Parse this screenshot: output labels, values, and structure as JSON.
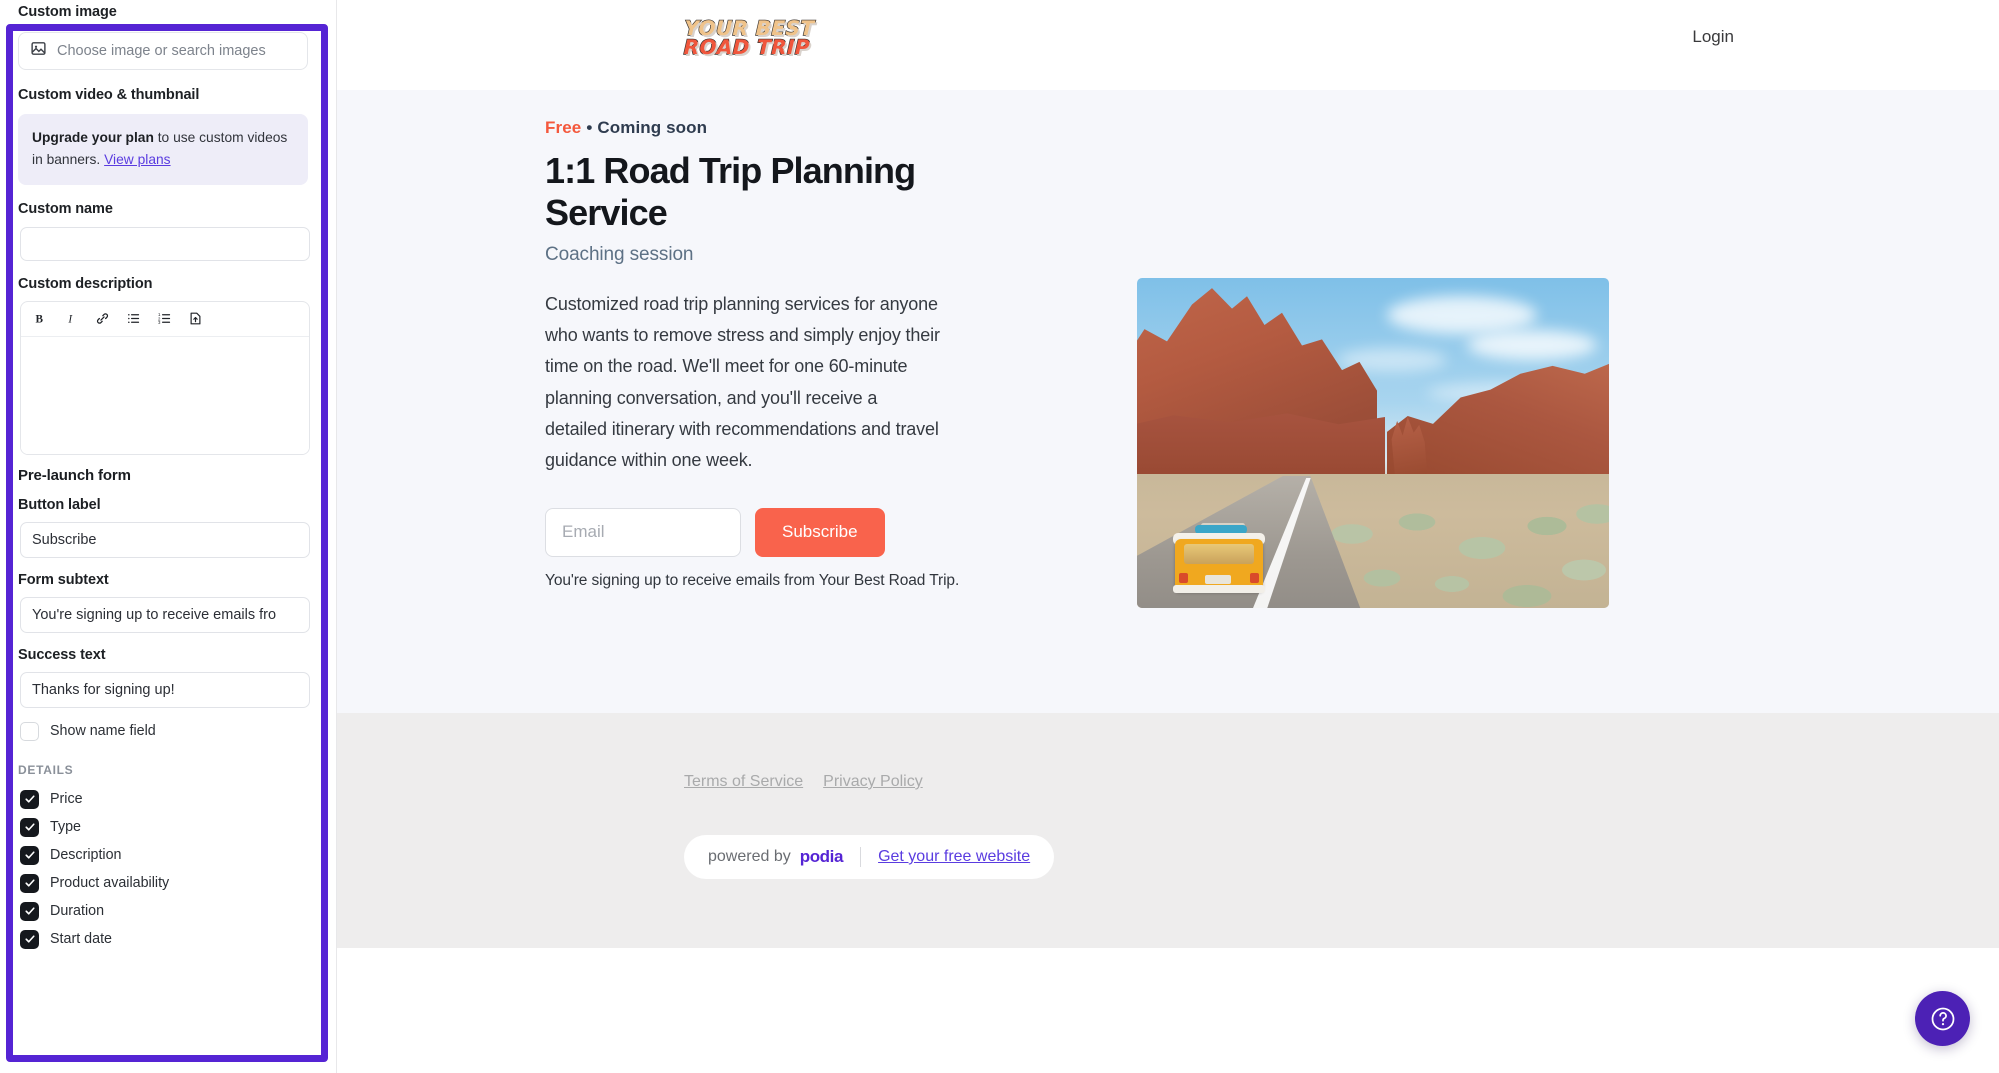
{
  "editor": {
    "custom_image": {
      "label": "Custom image",
      "placeholder": "Choose image or search images",
      "icon": "image-icon"
    },
    "custom_video": {
      "label": "Custom video & thumbnail",
      "upgrade_bold": "Upgrade your plan",
      "upgrade_rest": " to use custom videos in banners. ",
      "upgrade_link": "View plans"
    },
    "custom_name": {
      "label": "Custom name",
      "value": ""
    },
    "custom_description": {
      "label": "Custom description",
      "value": "",
      "toolbar": [
        {
          "name": "bold-icon",
          "glyph": "B"
        },
        {
          "name": "italic-icon",
          "glyph": "I"
        },
        {
          "name": "link-icon",
          "glyph": "link"
        },
        {
          "name": "bulleted-list-icon",
          "glyph": "ul"
        },
        {
          "name": "numbered-list-icon",
          "glyph": "ol"
        },
        {
          "name": "file-upload-icon",
          "glyph": "upload"
        }
      ]
    },
    "prelaunch": {
      "section_title": "Pre-launch form",
      "button_label_label": "Button label",
      "button_label_value": "Subscribe",
      "form_subtext_label": "Form subtext",
      "form_subtext_value": "You're signing up to receive emails fro",
      "success_text_label": "Success text",
      "success_text_value": "Thanks for signing up!",
      "show_name_field_label": "Show name field",
      "show_name_field_checked": false
    },
    "details": {
      "heading": "DETAILS",
      "items": [
        {
          "label": "Price",
          "checked": true
        },
        {
          "label": "Type",
          "checked": true
        },
        {
          "label": "Description",
          "checked": true
        },
        {
          "label": "Product availability",
          "checked": true
        },
        {
          "label": "Duration",
          "checked": true
        },
        {
          "label": "Start date",
          "checked": true
        }
      ]
    },
    "highlight_color": "#5524d4"
  },
  "preview": {
    "header": {
      "logo_line1": "YOUR BEST",
      "logo_line2": "ROAD TRIP",
      "login_label": "Login"
    },
    "hero": {
      "badge_price": "Free",
      "badge_separator": "•",
      "badge_status": "Coming soon",
      "title": "1:1 Road Trip Planning Service",
      "subtitle": "Coaching session",
      "description": "Customized road trip planning services for anyone who wants to remove stress and simply enjoy their time on the road. We'll meet for one 60-minute planning conversation, and you'll receive a detailed itinerary with recommendations and travel guidance within one week.",
      "email_placeholder": "Email",
      "subscribe_label": "Subscribe",
      "form_note": "You're signing up to receive emails from Your Best Road Trip.",
      "image_alt": "yellow van driving on desert road with red rock formations",
      "accent_color": "#f9634c",
      "background_color": "#f6f7fb"
    },
    "footer": {
      "terms_label": "Terms of Service",
      "privacy_label": "Privacy Policy",
      "powered_by_label": "powered by",
      "brand_label": "podia",
      "free_website_label": "Get your free website",
      "background_color": "#eeeded"
    },
    "help_button": {
      "name": "help-icon",
      "glyph": "?",
      "color": "#4c21b5"
    }
  }
}
